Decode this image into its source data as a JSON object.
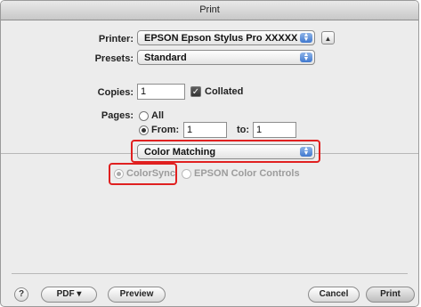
{
  "window": {
    "title": "Print"
  },
  "printer": {
    "label": "Printer:",
    "value": "EPSON Epson Stylus Pro XXXXX"
  },
  "presets": {
    "label": "Presets:",
    "value": "Standard"
  },
  "copies": {
    "label": "Copies:",
    "value": "1",
    "collated_label": "Collated",
    "collated_checked": true
  },
  "pages": {
    "label": "Pages:",
    "all_label": "All",
    "from_label": "From:",
    "from_value": "1",
    "to_label": "to:",
    "to_value": "1",
    "selected": "from"
  },
  "section": {
    "value": "Color Matching"
  },
  "color_options": {
    "colorsync_label": "ColorSync",
    "epson_label": "EPSON Color Controls",
    "selected": "colorsync"
  },
  "footer": {
    "help_label": "?",
    "pdf_label": "PDF ▾",
    "preview_label": "Preview",
    "cancel_label": "Cancel",
    "print_label": "Print"
  },
  "colors": {
    "highlight": "#e02020",
    "accent": "#3f78cf"
  }
}
